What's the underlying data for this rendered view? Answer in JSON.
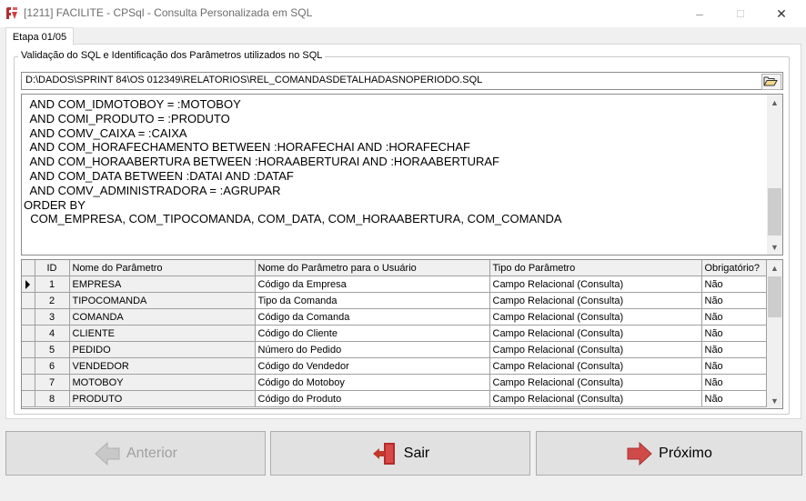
{
  "window": {
    "title": "[1211] FACILITE - CPSql - Consulta Personalizada em SQL",
    "minimize_glyph": "–",
    "maximize_glyph": "☐",
    "close_glyph": "✕"
  },
  "tabs": [
    {
      "label": "Etapa 01/05",
      "active": true
    }
  ],
  "group": {
    "title": "Validação do SQL e Identificação dos Parâmetros utilizados no SQL"
  },
  "file_path": "D:\\DADOS\\SPRINT 84\\OS 012349\\RELATORIOS\\REL_COMANDASDETALHADASNOPERIODO.SQL",
  "sql_lines": [
    "  AND COM_IDMOTOBOY = :MOTOBOY",
    "  AND COMI_PRODUTO = :PRODUTO",
    "  AND COMV_CAIXA = :CAIXA",
    "  AND COM_HORAFECHAMENTO BETWEEN :HORAFECHAI AND :HORAFECHAF",
    "  AND COM_HORAABERTURA BETWEEN :HORAABERTURAI AND :HORAABERTURAF",
    "  AND COM_DATA BETWEEN :DATAI AND :DATAF",
    "  AND COMV_ADMINISTRADORA = :AGRUPAR",
    "ORDER BY",
    "  COM_EMPRESA, COM_TIPOCOMANDA, COM_DATA, COM_HORAABERTURA, COM_COMANDA"
  ],
  "grid": {
    "columns": [
      "ID",
      "Nome do Parâmetro",
      "Nome do Parâmetro para o Usuário",
      "Tipo do Parâmetro",
      "Obrigatório?"
    ],
    "rows": [
      {
        "id": "1",
        "nome": "EMPRESA",
        "usuario": "Código da Empresa",
        "tipo": "Campo Relacional (Consulta)",
        "obrig": "Não"
      },
      {
        "id": "2",
        "nome": "TIPOCOMANDA",
        "usuario": "Tipo da Comanda",
        "tipo": "Campo Relacional (Consulta)",
        "obrig": "Não"
      },
      {
        "id": "3",
        "nome": "COMANDA",
        "usuario": "Código da Comanda",
        "tipo": "Campo Relacional (Consulta)",
        "obrig": "Não"
      },
      {
        "id": "4",
        "nome": "CLIENTE",
        "usuario": "Código do Cliente",
        "tipo": "Campo Relacional (Consulta)",
        "obrig": "Não"
      },
      {
        "id": "5",
        "nome": "PEDIDO",
        "usuario": "Número do Pedido",
        "tipo": "Campo Relacional (Consulta)",
        "obrig": "Não"
      },
      {
        "id": "6",
        "nome": "VENDEDOR",
        "usuario": "Código do Vendedor",
        "tipo": "Campo Relacional (Consulta)",
        "obrig": "Não"
      },
      {
        "id": "7",
        "nome": "MOTOBOY",
        "usuario": "Código do Motoboy",
        "tipo": "Campo Relacional (Consulta)",
        "obrig": "Não"
      },
      {
        "id": "8",
        "nome": "PRODUTO",
        "usuario": "Código do Produto",
        "tipo": "Campo Relacional (Consulta)",
        "obrig": "Não"
      }
    ]
  },
  "buttons": {
    "anterior": "Anterior",
    "sair": "Sair",
    "proximo": "Próximo"
  },
  "colors": {
    "accent_red": "#c0392b",
    "disabled_text": "#a0a0a0"
  }
}
